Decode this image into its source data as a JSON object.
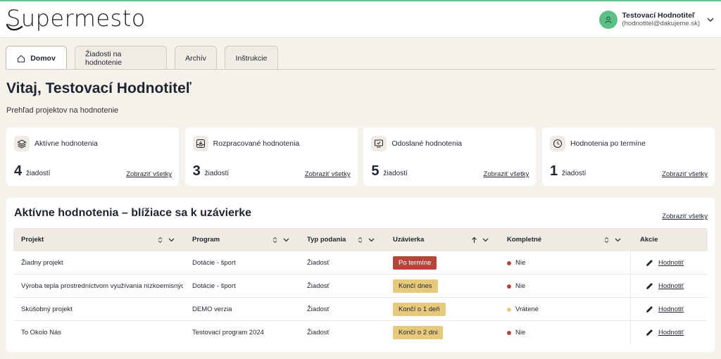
{
  "app": {
    "logo_text": "Supermesto",
    "accent_color": "#5cbf86"
  },
  "user": {
    "name": "Testovací Hodnotiteľ",
    "email": "(hodnotitel@dakujeme.sk)",
    "avatar_icon": "user-icon"
  },
  "tabs": [
    {
      "label": "Domov",
      "active": true,
      "icon": "home-icon"
    },
    {
      "label": "Žiadosti na hodnotenie",
      "active": false
    },
    {
      "label": "Archív",
      "active": false
    },
    {
      "label": "Inštrukcie",
      "active": false
    }
  ],
  "greeting": {
    "title": "Vitaj, Testovací Hodnotiteľ",
    "subtitle": "Prehľad projektov na hodnotenie"
  },
  "cards": [
    {
      "title": "Aktívne hodnotenia",
      "count": "4",
      "unit": "žiadostí",
      "link": "Zobraziť všetky",
      "icon": "layers-icon"
    },
    {
      "title": "Rozpracované hodnotenia",
      "count": "3",
      "unit": "žiadostí",
      "link": "Zobraziť všetky",
      "icon": "inbox-icon"
    },
    {
      "title": "Odoslané hodnotenia",
      "count": "5",
      "unit": "žiadostí",
      "link": "Zobraziť všetky",
      "icon": "monitor-check-icon"
    },
    {
      "title": "Hodnotenia po termíne",
      "count": "1",
      "unit": "žiadostí",
      "link": "Zobraziť všetky",
      "icon": "clock-icon"
    }
  ],
  "panel": {
    "title": "Aktívne hodnotenia – blížiace sa k uzávierke",
    "link": "Zobraziť všetky",
    "columns": [
      "Projekt",
      "Program",
      "Typ podania",
      "Uzávierka",
      "Kompletné",
      "Akcie"
    ],
    "rows": [
      {
        "project": "Žiadny projekt",
        "program": "Dotácie - šport",
        "type": "Žiadosť",
        "deadline": "Po termíne",
        "deadline_style": "red",
        "complete": "Nie",
        "complete_color": "#b5443c",
        "action": "Hodnotiť"
      },
      {
        "project": "Výroba tepla prostredníctvom využívania nízkoemisných zdroj...",
        "program": "Dotácie - šport",
        "type": "Žiadosť",
        "deadline": "Končí dnes",
        "deadline_style": "yellow",
        "complete": "Nie",
        "complete_color": "#b5443c",
        "action": "Hodnotiť"
      },
      {
        "project": "Skúšobný projekt",
        "program": "DEMO verzia",
        "type": "Žiadosť",
        "deadline": "Končí o 1 deň",
        "deadline_style": "yellow",
        "complete": "Vrátené",
        "complete_color": "#e7c97c",
        "action": "Hodnotiť"
      },
      {
        "project": "To Okolo Nás",
        "program": "Testovací program 2024",
        "type": "Žiadosť",
        "deadline": "Končí o 2 dni",
        "deadline_style": "yellow",
        "complete": "Nie",
        "complete_color": "#b5443c",
        "action": "Hodnotiť"
      }
    ]
  }
}
